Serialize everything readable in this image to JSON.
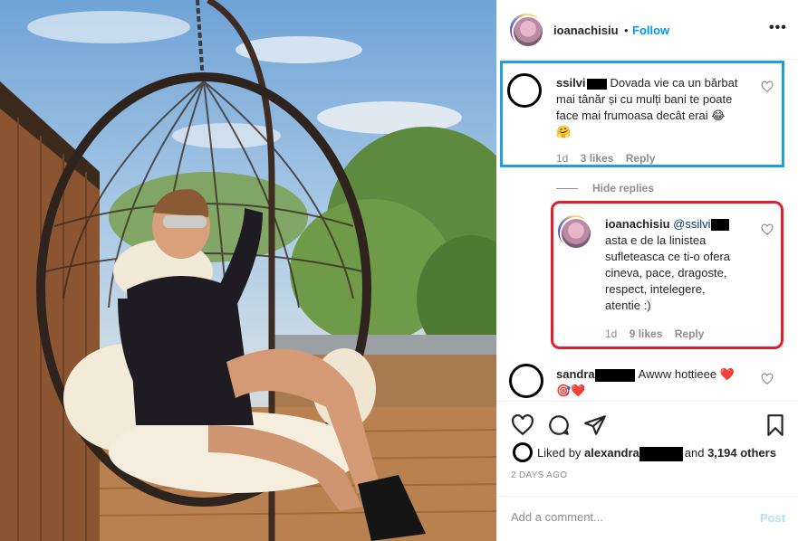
{
  "header": {
    "username": "ioanachisiu",
    "separator": "•",
    "follow_label": "Follow",
    "more_icon": "more-options-icon",
    "more_label": "•••"
  },
  "comment1": {
    "username": "ssilvi",
    "text_line1": "Dovada vie ca un bărbat",
    "text_line2": "mai tânăr și cu mulți bani te poate",
    "text_line3": "face mai frumoasa decât erai 😂",
    "text_line4": "🤗",
    "age": "1d",
    "likes": "3 likes",
    "reply_label": "Reply"
  },
  "hide_replies_label": "Hide replies",
  "reply1": {
    "username": "ioanachisiu",
    "mention": "@ssilvi",
    "lines": [
      "asta e de la linistea",
      "sufleteasca ce ti-o ofera",
      "cineva, pace, dragoste,",
      "respect, intelegere,",
      "atentie :)"
    ],
    "age": "1d",
    "likes": "9 likes",
    "reply_label": "Reply"
  },
  "comment2": {
    "username": "sandra",
    "text": "Awww hottieee ❤️",
    "text_line2": "🎯❤️"
  },
  "actions": {
    "like_icon": "heart-icon",
    "comment_icon": "comment-icon",
    "share_icon": "share-icon",
    "save_icon": "bookmark-icon"
  },
  "likes_summary": {
    "prefix": "Liked by",
    "user": "alexandra",
    "suffix": "and",
    "others": "3,194 others"
  },
  "timestamp": "2 DAYS AGO",
  "add_comment": {
    "placeholder": "Add a comment...",
    "post_label": "Post"
  },
  "colors": {
    "accent": "#0095f6",
    "annotation_blue": "#1fa1d7",
    "annotation_red": "#e0202d",
    "muted": "#8e8e8e"
  }
}
